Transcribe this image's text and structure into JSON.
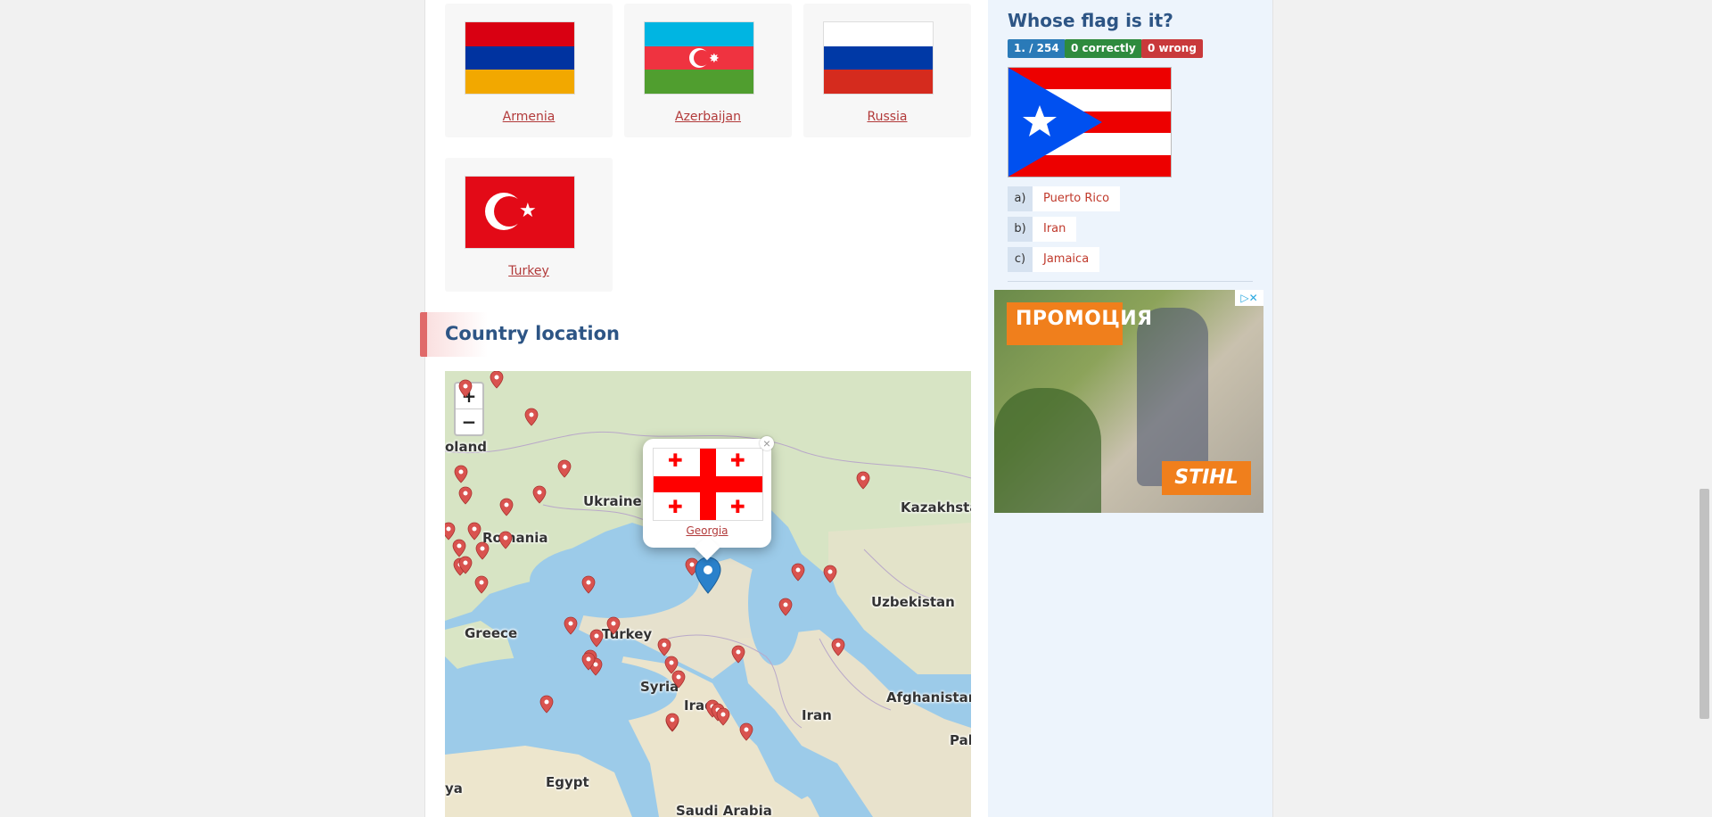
{
  "neighbors": [
    {
      "name": "Armenia",
      "flag": "armenia"
    },
    {
      "name": "Azerbaijan",
      "flag": "azerbaijan"
    },
    {
      "name": "Russia",
      "flag": "russia"
    },
    {
      "name": "Turkey",
      "flag": "turkey"
    }
  ],
  "section": {
    "title": "Country location"
  },
  "map": {
    "zoom_in": "+",
    "zoom_out": "−",
    "labels": [
      "oland",
      "Ukraine",
      "Romania",
      "Greece",
      "Turkey",
      "Syria",
      "Iraq",
      "Iran",
      "Egypt",
      "Saudi Arabia",
      "Kazakhsta",
      "Uzbekistan",
      "Afghanistan",
      "Pak",
      "ya"
    ],
    "popup": {
      "country": "Georgia",
      "close": "×"
    }
  },
  "quiz": {
    "title": "Whose flag is it?",
    "counter": "1. / 254",
    "correct": "0  correctly",
    "wrong": "0  wrong",
    "flag": "puerto-rico",
    "answers": [
      {
        "letter": "a)",
        "text": "Puerto Rico"
      },
      {
        "letter": "b)",
        "text": "Iran"
      },
      {
        "letter": "c)",
        "text": "Jamaica"
      }
    ]
  },
  "ad": {
    "promo": "ПРОМОЦИЯ",
    "brand": "STIHL",
    "close": "▷✕"
  },
  "colors": {
    "accent": "#2d5585",
    "link": "#b23a3a",
    "correct": "#2e8b3e",
    "wrong": "#c9393b",
    "counter": "#2a7ab8"
  }
}
